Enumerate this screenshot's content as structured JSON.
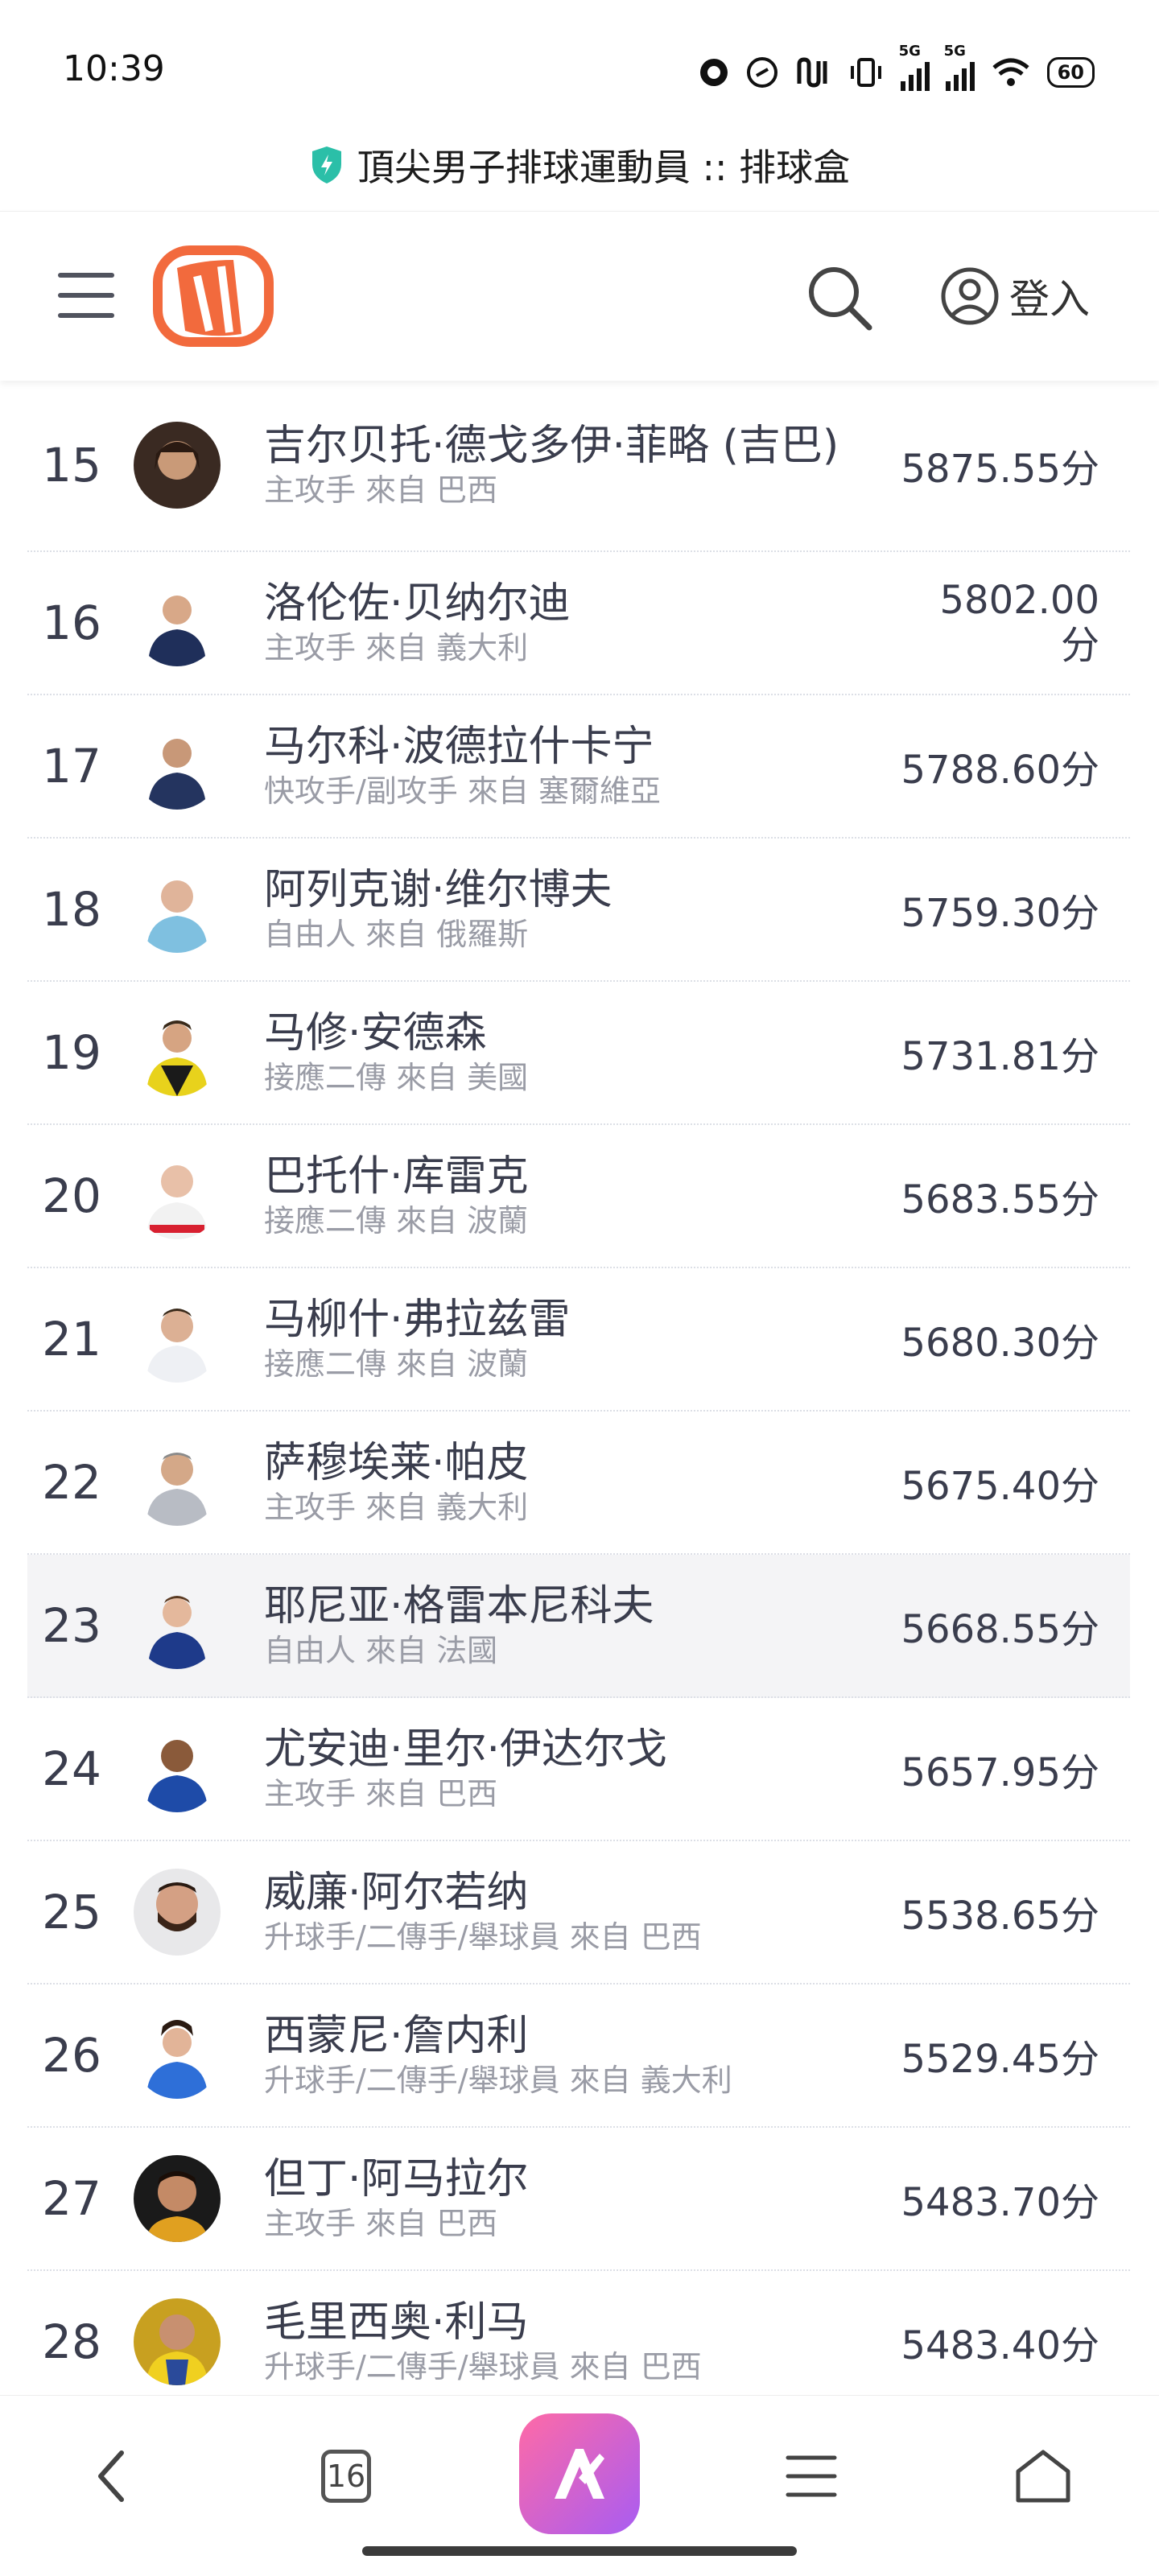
{
  "status_bar": {
    "time": "10:39",
    "network_labels": [
      "5G",
      "5G"
    ],
    "battery": "60"
  },
  "url_bar": {
    "title": "頂尖男子排球運動員 :: 排球盒"
  },
  "header": {
    "login_label": "登入"
  },
  "players": [
    {
      "rank": "15",
      "name": "吉尔贝托·德戈多伊·菲略 (吉巴)",
      "meta": "主攻手 來自 巴西",
      "score": "5875.55分"
    },
    {
      "rank": "16",
      "name": "洛伦佐·贝纳尔迪",
      "meta": "主攻手 來自 義大利",
      "score": "5802.00分"
    },
    {
      "rank": "17",
      "name": "马尔科·波德拉什卡宁",
      "meta": "快攻手/副攻手 來自 塞爾維亞",
      "score": "5788.60分"
    },
    {
      "rank": "18",
      "name": "阿列克谢·维尔博夫",
      "meta": "自由人 來自 俄羅斯",
      "score": "5759.30分"
    },
    {
      "rank": "19",
      "name": "马修·安德森",
      "meta": "接應二傳 來自 美國",
      "score": "5731.81分"
    },
    {
      "rank": "20",
      "name": "巴托什·库雷克",
      "meta": "接應二傳 來自 波蘭",
      "score": "5683.55分"
    },
    {
      "rank": "21",
      "name": "马柳什·弗拉兹雷",
      "meta": "接應二傳 來自 波蘭",
      "score": "5680.30分"
    },
    {
      "rank": "22",
      "name": "萨穆埃莱·帕皮",
      "meta": "主攻手 來自 義大利",
      "score": "5675.40分"
    },
    {
      "rank": "23",
      "name": "耶尼亚·格雷本尼科夫",
      "meta": "自由人 來自 法國",
      "score": "5668.55分"
    },
    {
      "rank": "24",
      "name": "尤安迪·里尔·伊达尔戈",
      "meta": "主攻手 來自 巴西",
      "score": "5657.95分"
    },
    {
      "rank": "25",
      "name": "威廉·阿尔若纳",
      "meta": "升球手/二傳手/舉球員 來自 巴西",
      "score": "5538.65分"
    },
    {
      "rank": "26",
      "name": "西蒙尼·詹内利",
      "meta": "升球手/二傳手/舉球員 來自 義大利",
      "score": "5529.45分"
    },
    {
      "rank": "27",
      "name": "但丁·阿马拉尔",
      "meta": "主攻手 來自 巴西",
      "score": "5483.70分"
    },
    {
      "rank": "28",
      "name": "毛里西奥·利马",
      "meta": "升球手/二傳手/舉球員 來自 巴西",
      "score": "5483.40分"
    }
  ],
  "bottom_nav": {
    "tab_count": "16"
  },
  "colors": {
    "brand": "#f26a3d",
    "text": "#3a3d4d",
    "muted": "#9a9ca6",
    "highlight_row": "#f4f4f6"
  }
}
